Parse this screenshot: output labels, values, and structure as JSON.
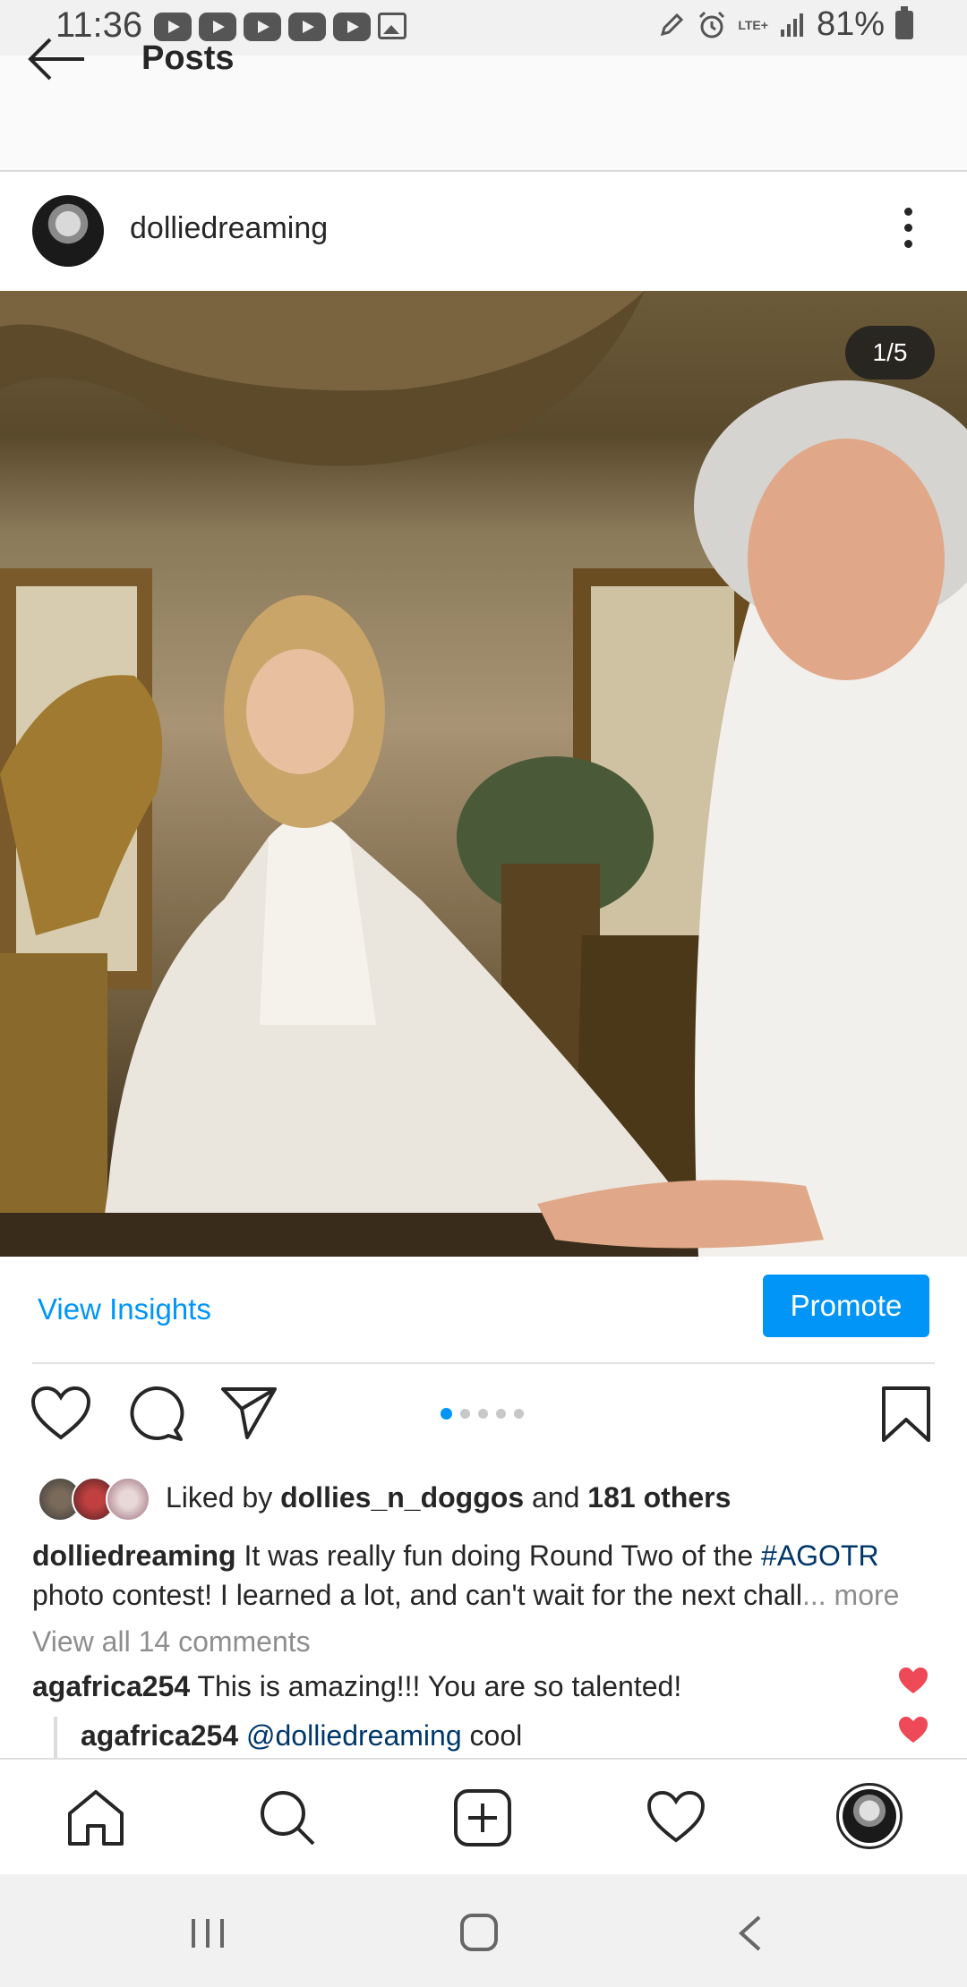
{
  "status_bar": {
    "time": "11:36",
    "battery": "81%",
    "network": "LTE+"
  },
  "header": {
    "title": "Posts"
  },
  "post": {
    "username": "dolliedreaming",
    "image_counter": "1/5",
    "page_dots": 5,
    "active_dot": 1,
    "view_insights": "View Insights",
    "promote": "Promote",
    "liked_by_prefix": "Liked by",
    "liked_by_user": "dollies_n_doggos",
    "liked_by_and": "and",
    "liked_by_others": "181 others",
    "caption_user": "dolliedreaming",
    "caption_text": "It was really fun doing Round Two of the",
    "caption_hashtag": "#AGOTR",
    "caption_text2": "photo contest! I learned a lot, and can't wait for the next chall",
    "caption_more": "... more",
    "view_all_comments": "View all 14 comments"
  },
  "comments": [
    {
      "user": "agafrica254",
      "text": "This is amazing!!! You are so talented!"
    },
    {
      "user": "agafrica254",
      "mention": "@dolliedreaming",
      "text": "cool"
    }
  ],
  "colors": {
    "accent": "#0095f6",
    "heart": "#ed4956",
    "hashtag": "#00376b"
  },
  "icons": {
    "back": "arrow-left-icon",
    "options": "kebab-menu-icon",
    "like": "heart-outline-icon",
    "comment": "speech-bubble-icon",
    "share": "paper-plane-icon",
    "save": "bookmark-icon",
    "nav_home": "home-icon",
    "nav_search": "search-icon",
    "nav_add": "plus-square-icon",
    "nav_activity": "heart-outline-icon"
  }
}
